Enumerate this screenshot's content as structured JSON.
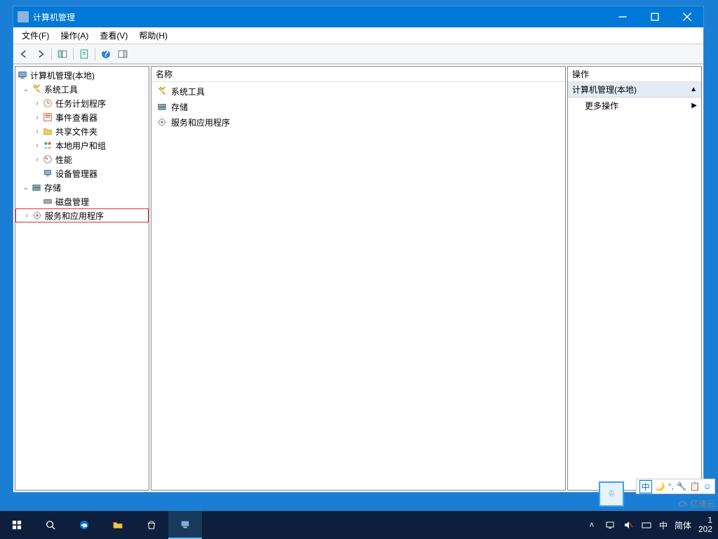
{
  "window": {
    "title": "计算机管理"
  },
  "menubar": {
    "file": "文件(F)",
    "action": "操作(A)",
    "view": "查看(V)",
    "help": "帮助(H)"
  },
  "tree": {
    "root": "计算机管理(本地)",
    "system_tools": "系统工具",
    "task_scheduler": "任务计划程序",
    "event_viewer": "事件查看器",
    "shared_folders": "共享文件夹",
    "local_users": "本地用户和组",
    "performance": "性能",
    "device_manager": "设备管理器",
    "storage": "存储",
    "disk_management": "磁盘管理",
    "services_apps": "服务和应用程序"
  },
  "list": {
    "header_name": "名称",
    "items": [
      "系统工具",
      "存储",
      "服务和应用程序"
    ]
  },
  "actions": {
    "header": "操作",
    "section": "计算机管理(本地)",
    "more": "更多操作"
  },
  "taskbar": {
    "ime1": "中",
    "ime2": "简体",
    "time_partial": "1",
    "date_partial": "202"
  },
  "ime_float": {
    "char": "中",
    "moon": "🌙",
    "punct": "°,",
    "wrench": "🔧",
    "clip": "📋",
    "smile": "☺"
  },
  "watermark": "亿速云"
}
